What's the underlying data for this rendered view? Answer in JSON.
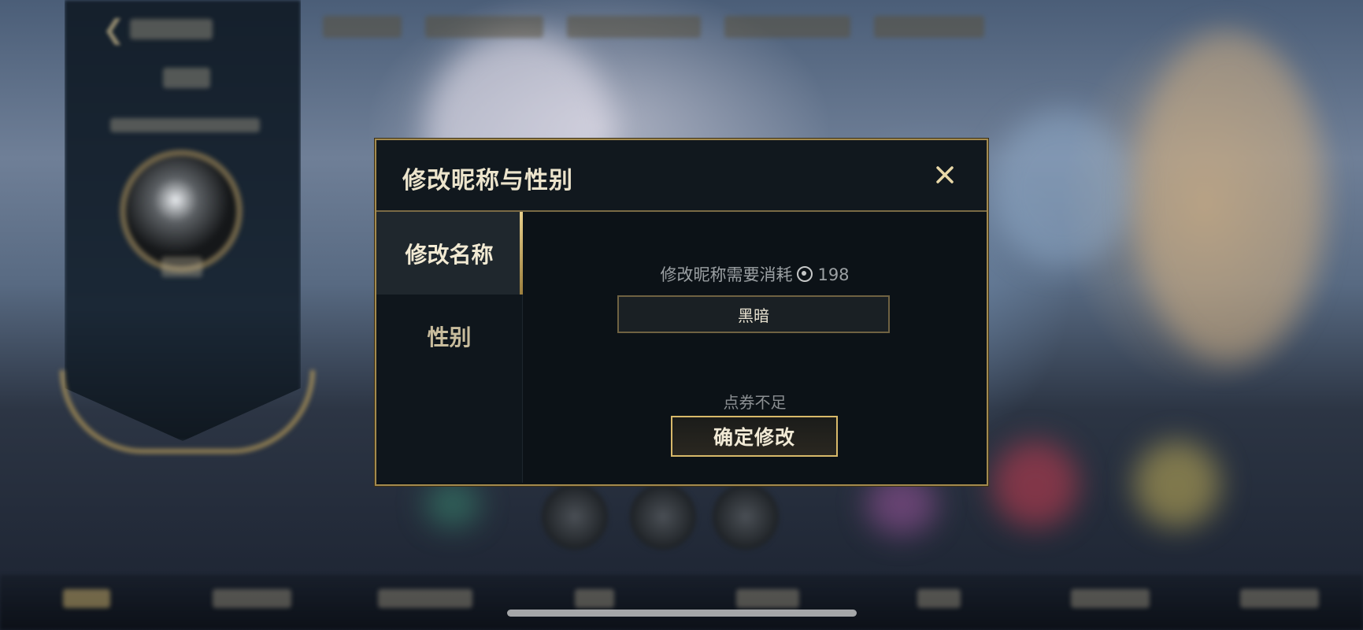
{
  "dialog": {
    "title": "修改昵称与性别",
    "close_icon": "close-icon",
    "tabs": [
      {
        "label": "修改名称",
        "active": true
      },
      {
        "label": "性别",
        "active": false
      }
    ],
    "cost": {
      "text": "修改昵称需要消耗",
      "currency_icon": "coin-icon",
      "amount": "198"
    },
    "name_input_value": "黑暗",
    "status_text": "点券不足",
    "confirm_label": "确定修改"
  },
  "colors": {
    "accent_gold": "#d8b96a",
    "dialog_bg": "#0c1217",
    "title_text": "#ece4cc"
  }
}
